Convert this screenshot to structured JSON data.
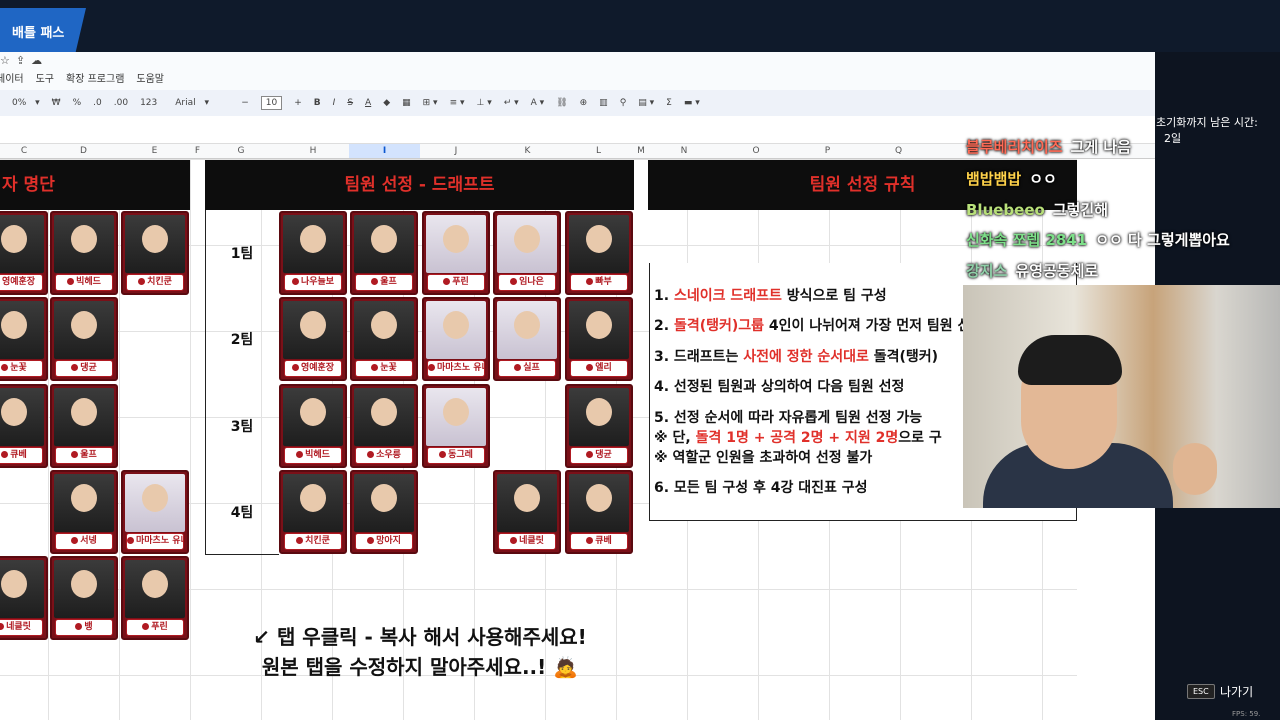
{
  "app": {
    "tab_label": "배틀 패스"
  },
  "menu": {
    "items": [
      "데이터",
      "도구",
      "확장 프로그램",
      "도움말"
    ]
  },
  "toolbar": {
    "zoom": "0%",
    "format_won": "₩",
    "format_pct": "%",
    "dec_less": ".0",
    "dec_more": ".00",
    "num_fmt": "123",
    "font": "Arial",
    "minus": "−",
    "font_size": "10",
    "plus": "+",
    "bold": "B",
    "italic": "I",
    "strike": "S",
    "text_color": "A",
    "sum": "Σ"
  },
  "columns": [
    {
      "id": "C"
    },
    {
      "id": "D"
    },
    {
      "id": "E"
    },
    {
      "id": "F"
    },
    {
      "id": "G"
    },
    {
      "id": "H"
    },
    {
      "id": "I",
      "selected": true
    },
    {
      "id": "J"
    },
    {
      "id": "K"
    },
    {
      "id": "L"
    },
    {
      "id": "M"
    },
    {
      "id": "N"
    },
    {
      "id": "O"
    },
    {
      "id": "P"
    },
    {
      "id": "Q"
    }
  ],
  "roster": {
    "header": "자 명단",
    "cards": [
      [
        "영예훈장",
        "빅헤드",
        "치킨쿤"
      ],
      [
        "눈꽃",
        "댕균",
        ""
      ],
      [
        "큐베",
        "울프",
        ""
      ],
      [
        "",
        "서넹",
        "마마츠노 유니"
      ],
      [
        "네클릿",
        "뱅",
        "푸린"
      ]
    ]
  },
  "draft": {
    "header": "팀원 선정 - 드래프트",
    "teams": [
      {
        "label": "1팀",
        "members": [
          "나우늘보",
          "울프",
          "푸린",
          "임나은",
          "빠부"
        ]
      },
      {
        "label": "2팀",
        "members": [
          "영예훈장",
          "눈꽃",
          "마마츠노 유니",
          "실프",
          "엘리"
        ]
      },
      {
        "label": "3팀",
        "members": [
          "빅헤드",
          "소우릉",
          "동그레",
          "",
          "댕균"
        ]
      },
      {
        "label": "4팀",
        "members": [
          "치킨쿤",
          "망아지",
          "",
          "네클릿",
          "큐베"
        ]
      }
    ],
    "note_line1": "↙ 탭 우클릭 - 복사 해서 사용해주세요!",
    "note_line2": "원본 탭을 수정하지 말아주세요..! 🙇"
  },
  "rules": {
    "header": "팀원 선정 규칙",
    "r1_a": "1. ",
    "r1_red": "스네이크 드래프트",
    "r1_b": " 방식으로 팀 구성",
    "r2_a": "2. ",
    "r2_red": "돌격(탱커)그룹",
    "r2_b": " 4인이 나뉘어져 가장 먼저 팀원 선정",
    "r3_a": "3. 드래프트는 ",
    "r3_red": "사전에 정한 순서대로",
    "r3_b": " 돌격(탱커)",
    "r4": "4. 선정된 팀원과 상의하여 다음 팀원 선정",
    "r5": "5. 선정 순서에 따라 자유롭게 팀원 선정 가능",
    "r5a_a": "  ※ 단, ",
    "r5a_red": "돌격 1명 + 공격 2명 + 지원 2명",
    "r5a_b": "으로 구",
    "r5b": "  ※ 역할군 인원을 초과하여 선정 불가",
    "r6": "6. 모든 팀 구성 후 4강 대진표 구성"
  },
  "overlay": {
    "timer_text": "초기화까지 남은 시간:",
    "timer_value": "2일",
    "chat": [
      {
        "user": "블루베리치이즈",
        "msg": "그게 나음",
        "color": "#ff6a55"
      },
      {
        "user": "뱀밥뱀밥",
        "msg": "ㅇㅇ",
        "color": "#ffd24a"
      },
      {
        "user": "Bluebeeo",
        "msg": "그렇긴해",
        "color": "#b8e07a"
      },
      {
        "user": "신화속 쪼렙 2841",
        "msg": "ㅇㅇ 다 그렇게뽑아요",
        "color": "#7ee08a"
      },
      {
        "user": "강지스",
        "msg": "유영공동체로",
        "color": "#8fd0a8"
      }
    ],
    "esc_key": "ESC",
    "exit_label": "나가기",
    "fps": "FPS: 59."
  }
}
